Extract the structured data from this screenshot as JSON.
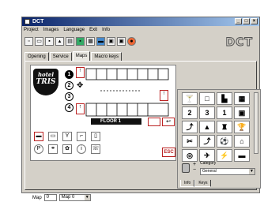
{
  "window": {
    "title": "DCT",
    "controls": [
      "_",
      "□",
      "×"
    ]
  },
  "menu": [
    "Project",
    "Images",
    "Language",
    "Exit",
    "Info"
  ],
  "toolbar": {
    "icons": [
      "new-icon",
      "open-icon",
      "save-icon",
      "print-icon",
      "export-icon",
      "image-icon",
      "grid-icon",
      "screen-icon",
      "printer-icon",
      "printer2-icon",
      "help-icon"
    ]
  },
  "brand": "DCT",
  "tabs": [
    "Opening",
    "Service",
    "Maps",
    "Macro keys"
  ],
  "map": {
    "hotel_line1": "hotel",
    "hotel_line2": "TRIS",
    "circles": [
      "1",
      "2",
      "3",
      "4"
    ],
    "floor_label": "FLOOR 1",
    "esc_label": "ESC"
  },
  "map_selector": {
    "label": "Map",
    "number": "0",
    "name": "Map 0"
  },
  "icon_grid": {
    "items": [
      "🍸",
      "□",
      "▙",
      "▦",
      "2",
      "3",
      "1",
      "▣",
      "⤴",
      "▲",
      "♜",
      "🏆",
      "✂",
      "⤴",
      "⚽",
      "⌂",
      "◎",
      "✈",
      "⚡",
      "▬"
    ]
  },
  "category": {
    "label": "Category",
    "value": "General"
  },
  "subtabs": [
    "Info",
    "Keys"
  ]
}
